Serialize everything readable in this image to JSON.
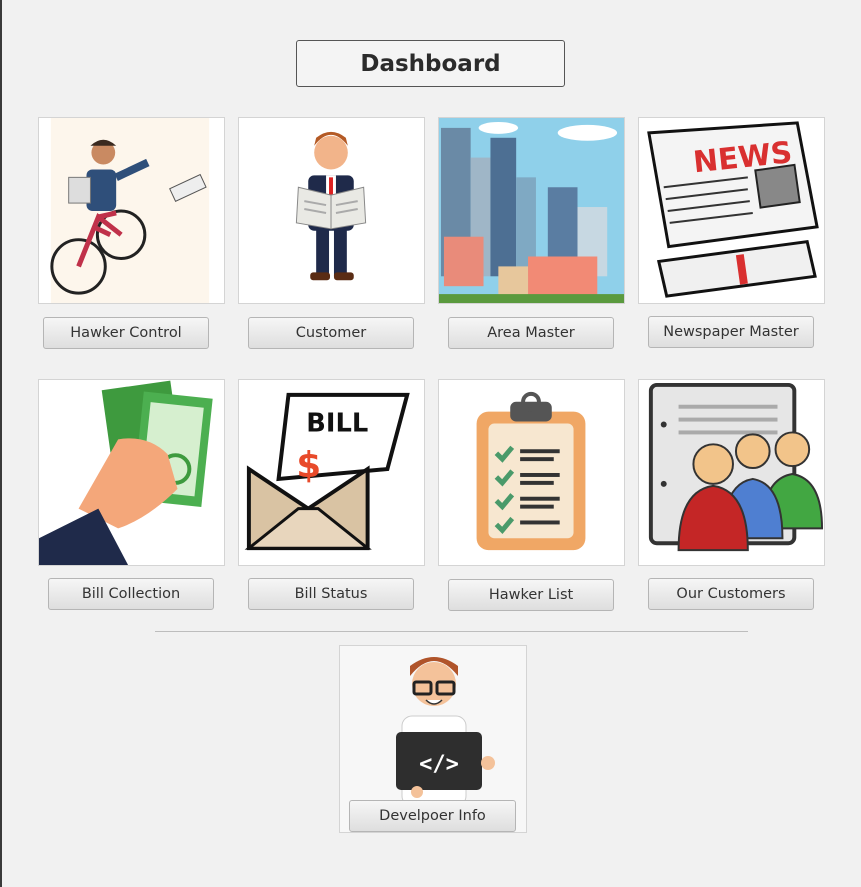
{
  "header": {
    "title": "Dashboard"
  },
  "tiles": [
    {
      "label": "Hawker Control",
      "icon": "cyclist-icon"
    },
    {
      "label": "Customer",
      "icon": "newspaper-reader-icon"
    },
    {
      "label": "Area Master",
      "icon": "city-skyline-icon"
    },
    {
      "label": "Newspaper Master",
      "icon": "newspaper-icon",
      "image_text": "NEWS"
    },
    {
      "label": "Bill Collection",
      "icon": "cash-in-hand-icon"
    },
    {
      "label": "Bill Status",
      "icon": "bill-envelope-icon",
      "image_text": "BILL"
    },
    {
      "label": "Hawker List",
      "icon": "checklist-clipboard-icon"
    },
    {
      "label": "Our Customers",
      "icon": "customer-group-icon"
    }
  ],
  "developer": {
    "label": "Develpoer Info",
    "icon": "developer-laptop-icon",
    "image_text": "</>"
  },
  "colors": {
    "background": "#f1f1f1",
    "button": "#e3e3e3",
    "border": "#555555"
  }
}
